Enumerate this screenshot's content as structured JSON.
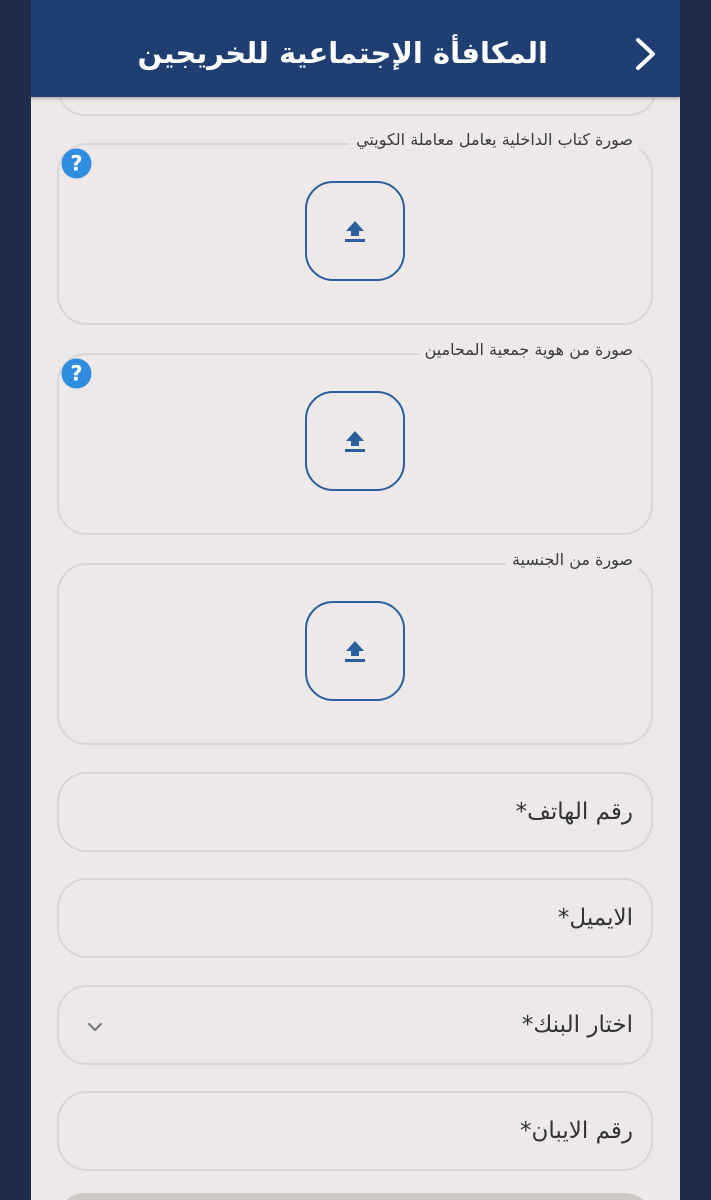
{
  "header": {
    "title": "المكافأة الإجتماعية للخريجين",
    "back_icon": "chevron-right-icon"
  },
  "uploads": [
    {
      "label": "صورة كتاب الداخلية يعامل معاملة الكويتي",
      "has_help": true
    },
    {
      "label": "صورة من هوية جمعية المحامين",
      "has_help": true
    },
    {
      "label": "صورة من الجنسية",
      "has_help": false
    }
  ],
  "form": {
    "phone_label": "رقم الهاتف*",
    "email_label": "الايميل*",
    "bank_label": "اختار البنك*",
    "iban_label": "رقم الايبان*"
  },
  "colors": {
    "header_bg": "#1f3f72",
    "page_bg": "#ece9e8",
    "outer_bg": "#1e2c4a",
    "accent_blue": "#2b5f9e",
    "help_blue": "#2f8de0"
  }
}
